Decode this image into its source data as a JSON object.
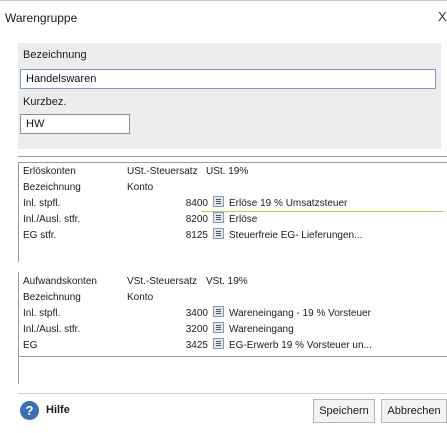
{
  "window": {
    "title": "Warengruppe",
    "close_glyph": "X"
  },
  "form": {
    "bezeichnung_label": "Bezeichnung",
    "bezeichnung_value": "Handelswaren",
    "kurzbez_label": "Kurzbez.",
    "kurzbez_value": "HW"
  },
  "erloes": {
    "header": {
      "col1": "Erlöskonten",
      "col2": "USt.-Steuersatz",
      "col3": "USt. 19%"
    },
    "subheader": {
      "col1": "Bezeichnung",
      "col2": "Konto"
    },
    "rows": [
      {
        "label": "Inl. stpfl.",
        "konto": "8400",
        "desc": "Erlöse 19 % Umsatzsteuer"
      },
      {
        "label": "Inl./Ausl. stfr.",
        "konto": "8200",
        "desc": "Erlöse"
      },
      {
        "label": "EG stfr.",
        "konto": "8125",
        "desc": "Steuerfreie EG- Lieferungen..."
      }
    ]
  },
  "aufwand": {
    "header": {
      "col1": "Aufwandskonten",
      "col2": "VSt.-Steuersatz",
      "col3": "VSt. 19%"
    },
    "subheader": {
      "col1": "Bezeichnung",
      "col2": "Konto"
    },
    "rows": [
      {
        "label": "Inl. stpfl.",
        "konto": "3400",
        "desc": "Wareneingang - 19 % Vorsteuer"
      },
      {
        "label": "Inl./Ausl. stfr.",
        "konto": "3200",
        "desc": "Wareneingang"
      },
      {
        "label": "EG",
        "konto": "3425",
        "desc": "EG-Erwerb 19 % Vorsteuer un..."
      }
    ]
  },
  "footer": {
    "help_label": "Hilfe",
    "help_icon_glyph": "?",
    "save_label": "Speichern",
    "cancel_label": "Abbrechen"
  },
  "colors": {
    "field_border": "#7a9cc4",
    "help_icon": "#3b6fb6",
    "highlight_line": "#b8d44a"
  }
}
